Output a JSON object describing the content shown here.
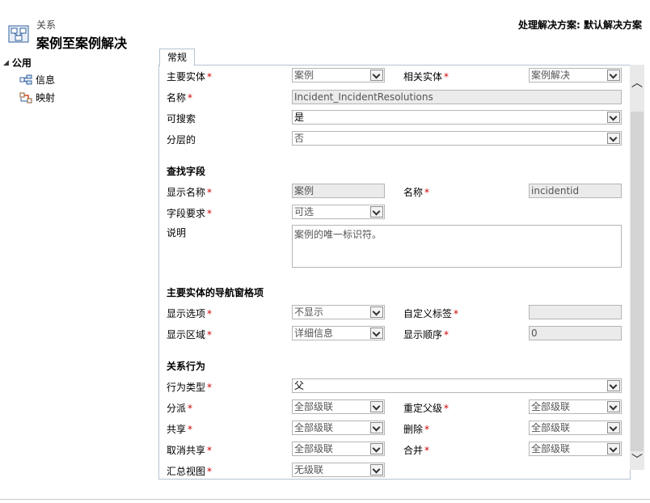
{
  "header": {
    "subtitle": "关系",
    "title": "案例至案例解决",
    "solution": "处理解决方案: 默认解决方案"
  },
  "nav": {
    "group": "公用",
    "items": [
      {
        "label": "信息",
        "icon": "info-icon"
      },
      {
        "label": "映射",
        "icon": "mapping-icon"
      }
    ]
  },
  "tab": "常规",
  "general": {
    "primary_entity": {
      "label": "主要实体",
      "value": "案例"
    },
    "related_entity": {
      "label": "相关实体",
      "value": "案例解决"
    },
    "name": {
      "label": "名称",
      "value": "Incident_IncidentResolutions"
    },
    "searchable": {
      "label": "可搜索",
      "value": "是"
    },
    "hierarchical": {
      "label": "分层的",
      "value": "否"
    }
  },
  "lookup": {
    "section": "查找字段",
    "display_name": {
      "label": "显示名称",
      "value": "案例"
    },
    "name": {
      "label": "名称",
      "value": "incidentid"
    },
    "requirement": {
      "label": "字段要求",
      "value": "可选"
    },
    "description": {
      "label": "说明",
      "value": "案例的唯一标识符。"
    }
  },
  "nav_pane": {
    "section": "主要实体的导航窗格项",
    "display_option": {
      "label": "显示选项",
      "value": "不显示"
    },
    "custom_label": {
      "label": "自定义标签",
      "value": ""
    },
    "display_area": {
      "label": "显示区域",
      "value": "详细信息"
    },
    "display_order": {
      "label": "显示顺序",
      "value": "0"
    }
  },
  "behavior": {
    "section": "关系行为",
    "type": {
      "label": "行为类型",
      "value": "父"
    },
    "assign": {
      "label": "分派",
      "value": "全部级联"
    },
    "reparent": {
      "label": "重定父级",
      "value": "全部级联"
    },
    "share": {
      "label": "共享",
      "value": "全部级联"
    },
    "delete": {
      "label": "删除",
      "value": "全部级联"
    },
    "unshare": {
      "label": "取消共享",
      "value": "全部级联"
    },
    "merge": {
      "label": "合并",
      "value": "全部级联"
    },
    "rollup": {
      "label": "汇总视图",
      "value": "无级联"
    }
  },
  "required_mark": "*",
  "colors": {
    "required": "#cc0000",
    "border": "#b6c3d3",
    "readonly_bg": "#ebebeb"
  }
}
